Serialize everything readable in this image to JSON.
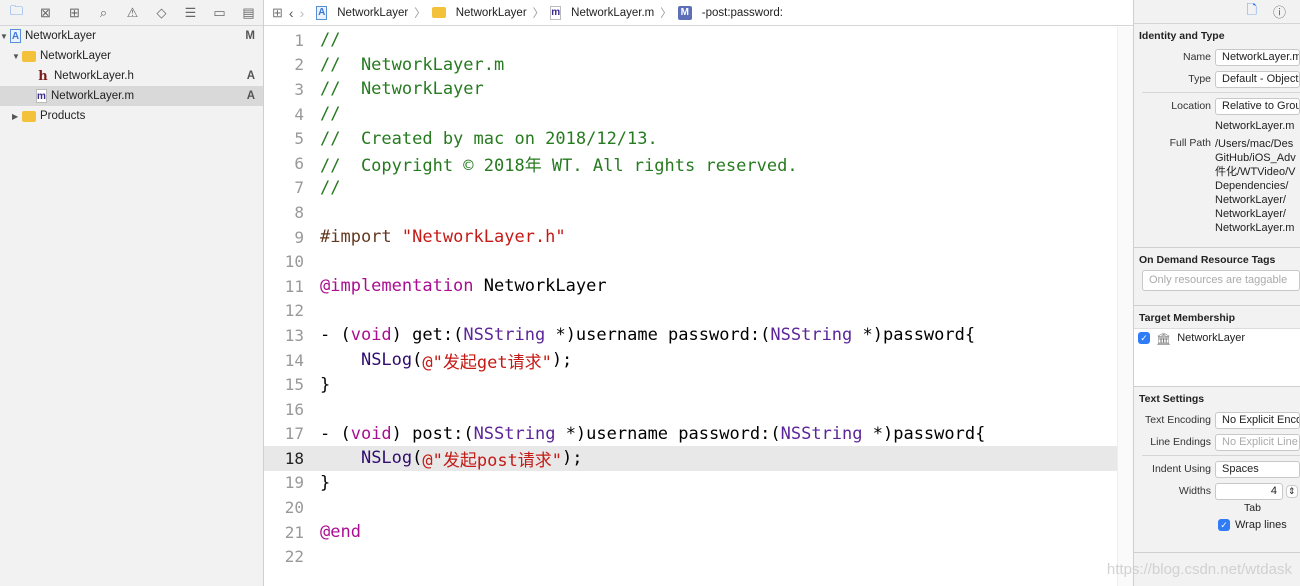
{
  "navigator": {
    "toolbar_icons": [
      "folder-icon",
      "source-control-icon",
      "symbol-icon",
      "search-icon",
      "warning-icon",
      "test-icon",
      "debug-icon",
      "breakpoint-icon",
      "report-icon"
    ],
    "items": [
      {
        "label": "NetworkLayer",
        "badge": "M",
        "type": "project"
      },
      {
        "label": "NetworkLayer",
        "badge": "",
        "type": "folder"
      },
      {
        "label": "NetworkLayer.h",
        "badge": "A",
        "type": "h"
      },
      {
        "label": "NetworkLayer.m",
        "badge": "A",
        "type": "m"
      },
      {
        "label": "Products",
        "badge": "",
        "type": "folder"
      }
    ]
  },
  "jumpbar": {
    "items": [
      "NetworkLayer",
      "NetworkLayer",
      "NetworkLayer.m",
      "-post:password:"
    ]
  },
  "code": {
    "current_line": 18,
    "lines": [
      [
        [
          "//",
          "c-comment"
        ]
      ],
      [
        [
          "//  NetworkLayer.m",
          "c-comment"
        ]
      ],
      [
        [
          "//  NetworkLayer",
          "c-comment"
        ]
      ],
      [
        [
          "//",
          "c-comment"
        ]
      ],
      [
        [
          "//  Created by mac on 2018/12/13.",
          "c-comment"
        ]
      ],
      [
        [
          "//  Copyright © 2018年 WT. All rights reserved.",
          "c-comment"
        ]
      ],
      [
        [
          "//",
          "c-comment"
        ]
      ],
      [],
      [
        [
          "#import ",
          "c-pre"
        ],
        [
          "\"NetworkLayer.h\"",
          "c-str"
        ]
      ],
      [],
      [
        [
          "@implementation",
          "c-kw"
        ],
        [
          " NetworkLayer",
          "c-plain"
        ]
      ],
      [],
      [
        [
          "- (",
          "c-plain"
        ],
        [
          "void",
          "c-kw"
        ],
        [
          ") get:(",
          "c-plain"
        ],
        [
          "NSString",
          "c-type"
        ],
        [
          " *)username password:(",
          "c-plain"
        ],
        [
          "NSString",
          "c-type"
        ],
        [
          " *)password{",
          "c-plain"
        ]
      ],
      [
        [
          "    ",
          "c-plain"
        ],
        [
          "NSLog",
          "c-fn"
        ],
        [
          "(",
          "c-plain"
        ],
        [
          "@\"发起get请求\"",
          "c-str"
        ],
        [
          ");",
          "c-plain"
        ]
      ],
      [
        [
          "}",
          "c-plain"
        ]
      ],
      [],
      [
        [
          "- (",
          "c-plain"
        ],
        [
          "void",
          "c-kw"
        ],
        [
          ") post:(",
          "c-plain"
        ],
        [
          "NSString",
          "c-type"
        ],
        [
          " *)username password:(",
          "c-plain"
        ],
        [
          "NSString",
          "c-type"
        ],
        [
          " *)password{",
          "c-plain"
        ]
      ],
      [
        [
          "    ",
          "c-plain"
        ],
        [
          "NSLog",
          "c-fn"
        ],
        [
          "(",
          "c-plain"
        ],
        [
          "@\"发起post请求\"",
          "c-str"
        ],
        [
          ");",
          "c-plain"
        ]
      ],
      [
        [
          "}",
          "c-plain"
        ]
      ],
      [],
      [
        [
          "@end",
          "c-kw"
        ]
      ],
      []
    ]
  },
  "inspector": {
    "identity": {
      "title": "Identity and Type",
      "name_label": "Name",
      "name": "NetworkLayer.m",
      "type_label": "Type",
      "type": "Default - Objective-C Source",
      "location_label": "Location",
      "location": "Relative to Group",
      "location_file": "NetworkLayer.m",
      "fullpath_label": "Full Path",
      "fullpath": [
        "/Users/mac/Des",
        "GitHub/iOS_Adv",
        "件化/WTVideo/V",
        "Dependencies/",
        "NetworkLayer/",
        "NetworkLayer/",
        "NetworkLayer.m"
      ]
    },
    "odr": {
      "title": "On Demand Resource Tags",
      "placeholder": "Only resources are taggable"
    },
    "target": {
      "title": "Target Membership",
      "item": "NetworkLayer",
      "checked": true
    },
    "text": {
      "title": "Text Settings",
      "encoding_label": "Text Encoding",
      "encoding": "No Explicit Encoding",
      "endings_label": "Line Endings",
      "endings": "No Explicit Line Endings",
      "indent_label": "Indent Using",
      "indent": "Spaces",
      "widths_label": "Widths",
      "width": "4",
      "tab_label": "Tab",
      "wrap_label": "Wrap lines",
      "wrap": true
    }
  },
  "watermark": "https://blog.csdn.net/wtdask"
}
